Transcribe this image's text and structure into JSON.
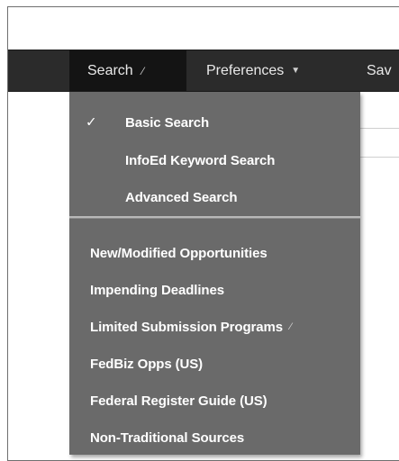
{
  "nav": {
    "items": [
      {
        "label": "Search",
        "icon": "pencil-caret-icon",
        "active": true
      },
      {
        "label": "Preferences",
        "icon": "chevron-down-icon",
        "active": false
      },
      {
        "label": "Sav",
        "active": false
      }
    ]
  },
  "search_menu": {
    "selected": "Basic Search",
    "check_glyph": "✓",
    "search_types": [
      {
        "label": "Basic Search",
        "checked": true
      },
      {
        "label": "InfoEd Keyword Search",
        "checked": false
      },
      {
        "label": "Advanced Search",
        "checked": false
      }
    ],
    "sources": [
      {
        "label": "New/Modified Opportunities"
      },
      {
        "label": "Impending Deadlines"
      },
      {
        "label": "Limited Submission Programs",
        "has_submenu": true
      },
      {
        "label": "FedBiz Opps (US)"
      },
      {
        "label": "Federal Register Guide (US)"
      },
      {
        "label": "Non-Traditional Sources"
      }
    ]
  },
  "colors": {
    "navbar_bg": "#2b2b2b",
    "nav_active_bg": "#141414",
    "menu_bg": "#6a6a6a",
    "menu_text": "#ffffff"
  }
}
